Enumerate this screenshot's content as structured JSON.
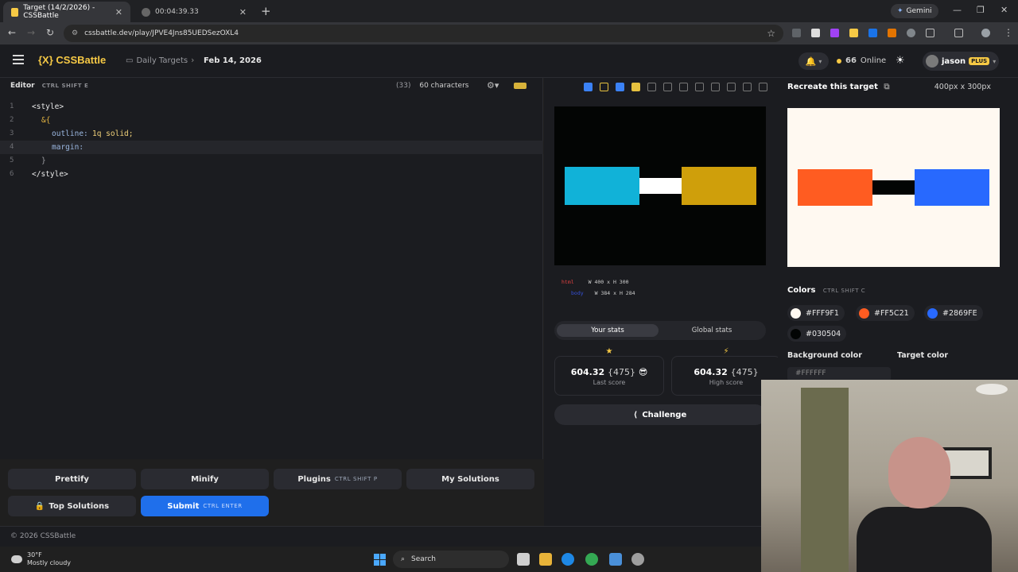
{
  "browser": {
    "tabs": [
      {
        "label": "Target (14/2/2026) - CSSBattle",
        "close": "✕",
        "active": true
      },
      {
        "label": "00:04:39.33",
        "close": "✕",
        "active": false
      }
    ],
    "new_tab": "+",
    "gemini_label": "Gemini",
    "url": "cssbattle.dev/play/JPVE4Jns85UEDSezOXL4"
  },
  "header": {
    "logo": "{X} CSSBattle",
    "breadcrumb_1": "Daily Targets",
    "breadcrumb_2": "Feb 14, 2026",
    "online_count": "66",
    "online_label": "Online",
    "username": "jason",
    "plan_badge": "PLUS"
  },
  "editor": {
    "title": "Editor",
    "shortcut": "CTRL  SHIFT  E",
    "count_paren": "(33)",
    "char_count": "60 characters",
    "lines": [
      {
        "n": "1",
        "text": "<style>"
      },
      {
        "n": "2",
        "text": "&{"
      },
      {
        "n": "3",
        "prop": "outline:",
        "val": "1q solid;"
      },
      {
        "n": "4",
        "prop": "margin:",
        "val": ""
      },
      {
        "n": "5",
        "text": "}"
      },
      {
        "n": "6",
        "text": "</style>"
      }
    ],
    "buttons": {
      "prettify": "Prettify",
      "minify": "Minify",
      "plugins": "Plugins",
      "plugins_key": "CTRL  SHIFT  P",
      "my_solutions": "My Solutions",
      "top_solutions": "Top Solutions",
      "submit": "Submit",
      "submit_key": "CTRL  ENTER"
    }
  },
  "preview": {
    "html_label": "html",
    "html_dims": "W 400 x H 300",
    "body_label": "body",
    "body_dims": "W 384 x H 284",
    "colors": {
      "bg": "#030504",
      "left": "#11b2d8",
      "middle": "#ffffff",
      "right": "#cf9f0b"
    }
  },
  "stats": {
    "tab_your": "Your stats",
    "tab_global": "Global stats",
    "last_score": "604.32",
    "last_chars": "{475}",
    "last_label": "Last score",
    "high_score": "604.32",
    "high_chars": "{475}",
    "high_label": "High score",
    "challenge": "Challenge"
  },
  "target": {
    "title": "Recreate this target",
    "size": "400px x 300px",
    "colors_title": "Colors",
    "colors_shortcut": "CTRL  SHIFT  C",
    "swatches": [
      {
        "hex": "#FFF9F1"
      },
      {
        "hex": "#FF5C21"
      },
      {
        "hex": "#2869FE"
      },
      {
        "hex": "#030504"
      }
    ],
    "bg_label": "Background color",
    "target_color_label": "Target color",
    "bg_value": "#FFFFFF"
  },
  "footer": {
    "copyright": "© 2026 CSSBattle"
  },
  "taskbar": {
    "temp": "30°F",
    "condition": "Mostly cloudy",
    "search": "Search"
  }
}
